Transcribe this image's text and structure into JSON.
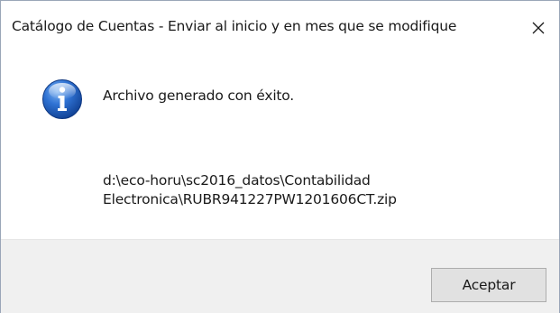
{
  "dialog": {
    "title": "Catálogo de Cuentas   - Enviar al inicio y en mes que se modifique",
    "close_icon": "close-icon",
    "icon": "info-icon",
    "message": "Archivo generado con éxito.",
    "path_line1": "d:\\eco-horu\\sc2016_datos\\Contabilidad",
    "path_line2": "Electronica\\RUBR941227PW1201606CT.zip",
    "ok_label": "Aceptar"
  },
  "colors": {
    "icon_blue": "#1c5fc4",
    "background": "#ffffff",
    "footer": "#f0f0f0",
    "button": "#e1e1e1"
  }
}
